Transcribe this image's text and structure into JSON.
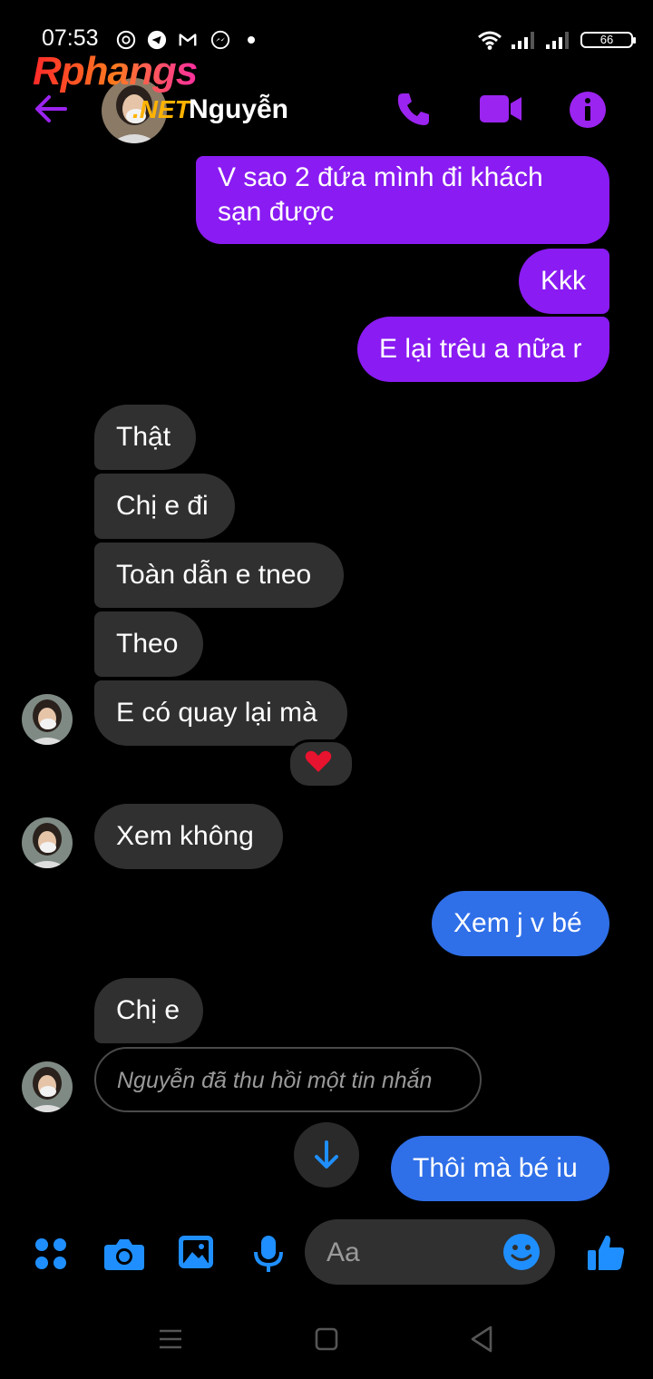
{
  "status_bar": {
    "time": "07:53",
    "battery": "66"
  },
  "watermark": {
    "brand": "Rphangs",
    "suffix": ".NET"
  },
  "header": {
    "contact_name": "Nguyễn"
  },
  "messages": [
    {
      "side": "out",
      "line1": "V sao 2 đứa mình đi khách",
      "line2": "sạn được"
    },
    {
      "side": "out",
      "text": "Kkk"
    },
    {
      "side": "out",
      "text": "E lại trêu a nữa r"
    },
    {
      "side": "in",
      "text": "Thật"
    },
    {
      "side": "in",
      "text": "Chị e đi"
    },
    {
      "side": "in",
      "text": "Toàn dẫn e tneo"
    },
    {
      "side": "in",
      "text": "Theo"
    },
    {
      "side": "in",
      "text": "E có quay lại mà",
      "reaction": "heart"
    },
    {
      "side": "in",
      "text": "Xem không"
    },
    {
      "side": "out",
      "text": "Xem j v bé"
    },
    {
      "side": "in",
      "text": "Chị e"
    },
    {
      "side": "in",
      "text": "Nguyễn đã thu hồi một tin nhắn",
      "unsent": true
    },
    {
      "side": "out",
      "text": "Thôi mà bé iu"
    }
  ],
  "composer": {
    "placeholder": "Aa"
  },
  "colors": {
    "sent_purple": "#8a1bf2",
    "sent_blue": "#2f6fe8",
    "received": "#303030",
    "accent": "#9b24f0",
    "composer_blue": "#1f8fff"
  }
}
